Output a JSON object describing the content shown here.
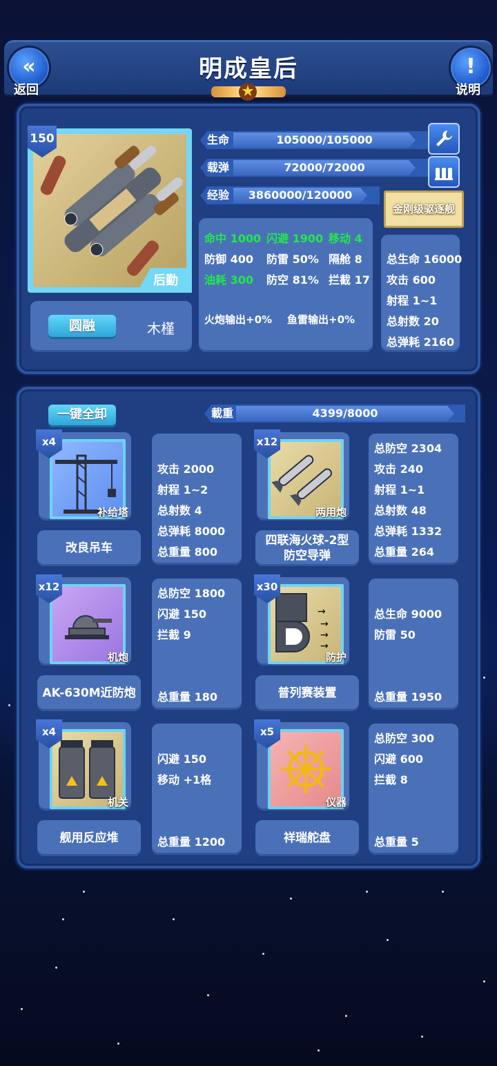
{
  "header": {
    "title": "明成皇后",
    "back_label": "返回",
    "help_label": "说明",
    "star_count": 1
  },
  "ship": {
    "level": "150",
    "role": "后勤",
    "trait_button": "圆融",
    "captain": "木槿",
    "class_badge": "金刚级驱逐舰"
  },
  "bars": {
    "hp_label": "生命",
    "hp_value": "105000/105000",
    "hp_fill": 1.0,
    "ammo_label": "载弹",
    "ammo_value": "72000/72000",
    "ammo_fill": 1.0,
    "exp_label": "经验",
    "exp_value": "3860000/120000",
    "exp_fill": 1.0
  },
  "attributes": {
    "row1": [
      "命中 1000",
      "闪避 1900",
      "移动 4"
    ],
    "row2": [
      "防御 400",
      "防雷 50%",
      "隔舱 8"
    ],
    "row3": [
      "油耗 300",
      "防空 81%",
      "拦截 17"
    ],
    "bonus_gun": "火炮输出+0%",
    "bonus_torpedo": "鱼雷输出+0%"
  },
  "totals": [
    "总生命 16000",
    "攻击 600",
    "射程 1~1",
    "总射数 20",
    "总弹耗 2160"
  ],
  "equipment": {
    "unequip_all": "一键全卸",
    "capacity_label": "載重",
    "capacity_value": "4399/8000",
    "capacity_fill": 0.55,
    "items": [
      {
        "count": "x4",
        "category": "补给塔",
        "name": "改良吊车",
        "stats": [
          "攻击 2000",
          "射程 1~2",
          "总射数 4",
          "总弹耗 8000",
          "总重量 800"
        ]
      },
      {
        "count": "x12",
        "category": "两用炮",
        "name": "四联海火球-2型\n防空导弹",
        "stats": [
          "总防空 2304",
          "攻击 240",
          "射程 1~1",
          "总射数 48",
          "总弹耗 1332",
          "总重量 264"
        ]
      },
      {
        "count": "x12",
        "category": "机炮",
        "name": "AK-630M近防炮",
        "stats": [
          "总防空 1800",
          "闪避 150",
          "拦截 9",
          "总重量 180"
        ]
      },
      {
        "count": "x30",
        "category": "防护",
        "name": "普列赛装置",
        "stats": [
          "总生命 9000",
          "防雷 50",
          "总重量 1950"
        ]
      },
      {
        "count": "x4",
        "category": "机关",
        "name": "舰用反应堆",
        "stats": [
          "闪避 150",
          "移动 +1格",
          "总重量 1200"
        ]
      },
      {
        "count": "x5",
        "category": "仪器",
        "name": "祥瑞舵盘",
        "stats": [
          "总防空 300",
          "闪避 600",
          "拦截 8",
          "总重量 5"
        ]
      }
    ]
  }
}
